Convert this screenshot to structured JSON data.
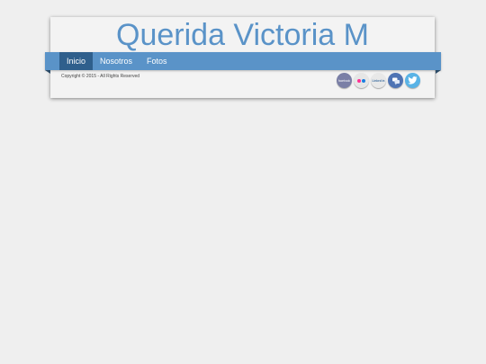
{
  "header": {
    "site_title": "Querida Victoria M"
  },
  "nav": {
    "items": [
      {
        "label": "Inicio",
        "active": true
      },
      {
        "label": "Nosotros",
        "active": false
      },
      {
        "label": "Fotos",
        "active": false
      }
    ]
  },
  "footer": {
    "copyright": "Copyright © 2015 - All Rights Reserved"
  },
  "social": {
    "facebook_label": "facebook",
    "linkedin_label": "Linked in",
    "icons": [
      "facebook-icon",
      "flickr-icon",
      "linkedin-icon",
      "chat-icon",
      "twitter-icon"
    ]
  },
  "colors": {
    "accent": "#5a93c8",
    "nav_active": "#2f5f8c",
    "background": "#efefef",
    "panel": "#f3f3f3"
  }
}
